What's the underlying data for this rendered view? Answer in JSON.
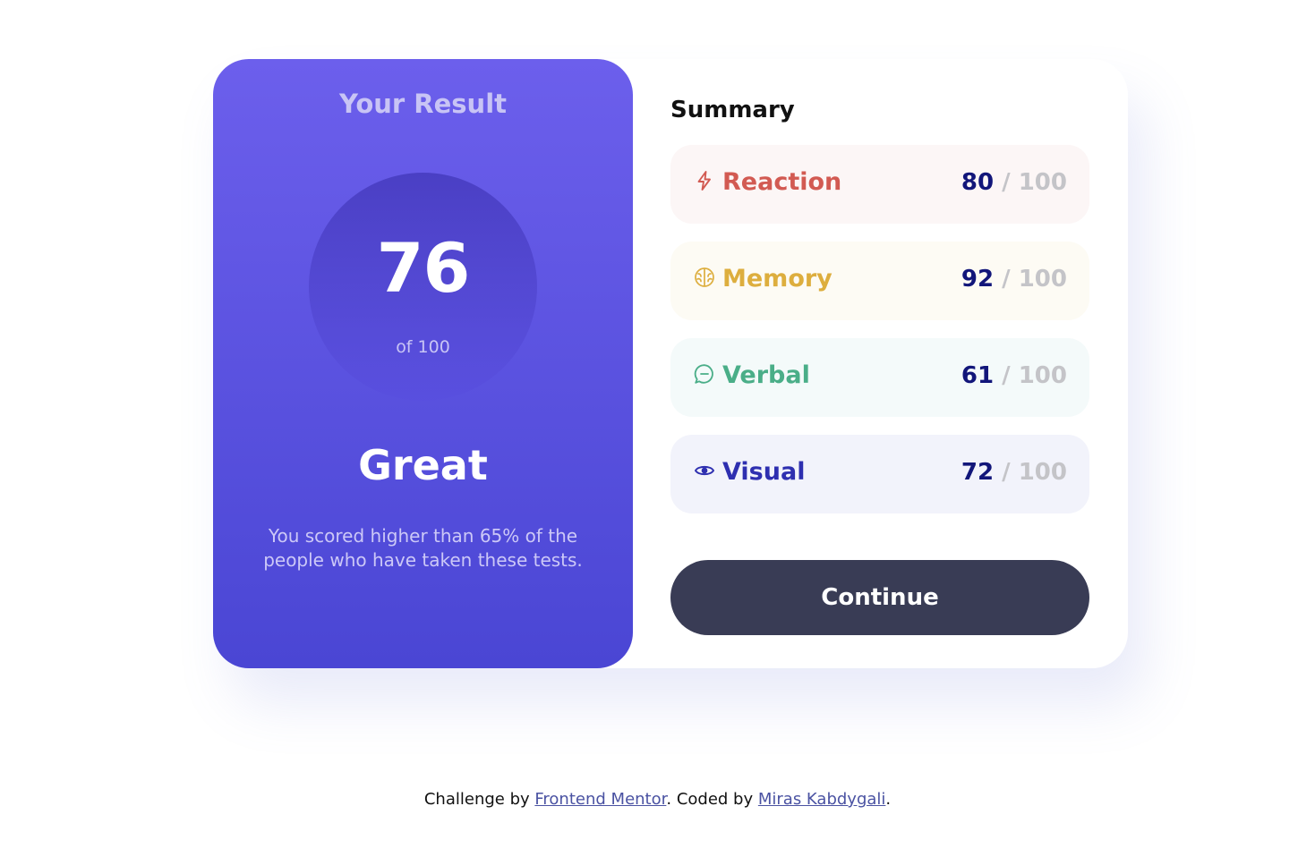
{
  "result": {
    "title": "Your Result",
    "score": "76",
    "of_label": "of 100",
    "rating": "Great",
    "description": "You scored higher than 65% of the people who have taken these tests."
  },
  "summary": {
    "title": "Summary",
    "separator": "/",
    "max": "100",
    "items": [
      {
        "label": "Reaction",
        "value": "80",
        "icon": "lightning-icon",
        "color": "#d25a52",
        "bg": "#fcf6f6"
      },
      {
        "label": "Memory",
        "value": "92",
        "icon": "brain-icon",
        "color": "#ddae3e",
        "bg": "#fdfbf4"
      },
      {
        "label": "Verbal",
        "value": "61",
        "icon": "speech-bubble-icon",
        "color": "#4aae88",
        "bg": "#f4fafa"
      },
      {
        "label": "Visual",
        "value": "72",
        "icon": "eye-icon",
        "color": "#2e2fb0",
        "bg": "#f2f3fb"
      }
    ],
    "continue_label": "Continue"
  },
  "footer": {
    "prefix": "Challenge by ",
    "link1": "Frontend Mentor",
    "middle": ". Coded by ",
    "link2": "Miras Kabdygali",
    "suffix": "."
  },
  "colors": {
    "accent_gradient_top": "#6c5fec",
    "accent_gradient_bottom": "#4a46d4",
    "button": "#393c55",
    "score_value": "#12167a"
  }
}
